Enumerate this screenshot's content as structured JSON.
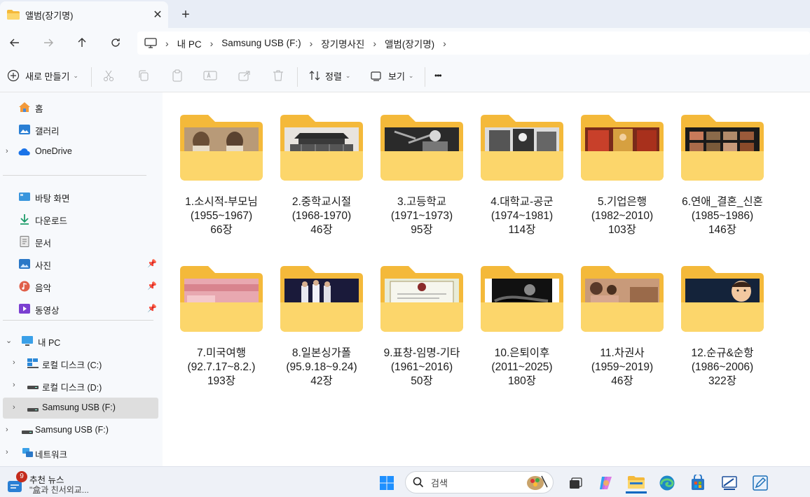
{
  "window": {
    "tab_title": "앨범(장기명)",
    "tab_close": "✕",
    "new_tab": "+"
  },
  "breadcrumb": [
    "내 PC",
    "Samsung USB (F:)",
    "장기명사진",
    "앨범(장기명)"
  ],
  "toolbar": {
    "new_label": "새로 만들기",
    "sort_label": "정렬",
    "view_label": "보기",
    "more_label": "•••"
  },
  "sidebar": {
    "home": "홈",
    "gallery": "갤러리",
    "onedrive": "OneDrive",
    "desktop": "바탕 화면",
    "downloads": "다운로드",
    "documents": "문서",
    "pictures": "사진",
    "music": "음악",
    "videos": "동영상",
    "this_pc": "내 PC",
    "drive_c": "로컬 디스크 (C:)",
    "drive_d": "로컬 디스크 (D:)",
    "drive_f": "Samsung USB (F:)",
    "usb_root": "Samsung USB (F:)",
    "network": "네트워크"
  },
  "folders": [
    {
      "line1": "1.소시적-부모님",
      "line2": "(1955~1967)",
      "line3": "66장",
      "thumb": "sepia-portrait"
    },
    {
      "line1": "2.중학교시절",
      "line2": "(1968-1970)",
      "line3": "46장",
      "thumb": "old-building"
    },
    {
      "line1": "3.고등학교",
      "line2": "(1971~1973)",
      "line3": "95장",
      "thumb": "bw-group"
    },
    {
      "line1": "4.대학교-공군",
      "line2": "(1974~1981)",
      "line3": "114장",
      "thumb": "bw-snapshots"
    },
    {
      "line1": "5.기업은행",
      "line2": "(1982~2010)",
      "line3": "103장",
      "thumb": "red-office"
    },
    {
      "line1": "6.연애_결혼_신혼",
      "line2": "(1985~1986)",
      "line3": "146장",
      "thumb": "photo-strip"
    },
    {
      "line1": "7.미국여행",
      "line2": "(92.7.17~8.2.)",
      "line3": "193장",
      "thumb": "pink-passport"
    },
    {
      "line1": "8.일본싱가폴",
      "line2": "(95.9.18~9.24)",
      "line3": "42장",
      "thumb": "night-group"
    },
    {
      "line1": "9.표창-임명-기타",
      "line2": "(1961~2016)",
      "line3": "50장",
      "thumb": "certificate"
    },
    {
      "line1": "10.은퇴이후",
      "line2": "(2011~2025)",
      "line3": "180장",
      "thumb": "dark-photo"
    },
    {
      "line1": "11.차권사",
      "line2": "(1959~2019)",
      "line3": "46장",
      "thumb": "family-color"
    },
    {
      "line1": "12.순규&순항",
      "line2": "(1986~2006)",
      "line3": "322장",
      "thumb": "child-portrait"
    }
  ],
  "taskbar": {
    "news_badge": "9",
    "news_title": "추천 뉴스",
    "news_sub": "\"盒과 친서외교...",
    "search_placeholder": "검색"
  },
  "colors": {
    "folder_back": "#f4b93a",
    "folder_front": "#fcd66b",
    "accent": "#0067c0",
    "bg_chrome": "#f7f9fc"
  }
}
